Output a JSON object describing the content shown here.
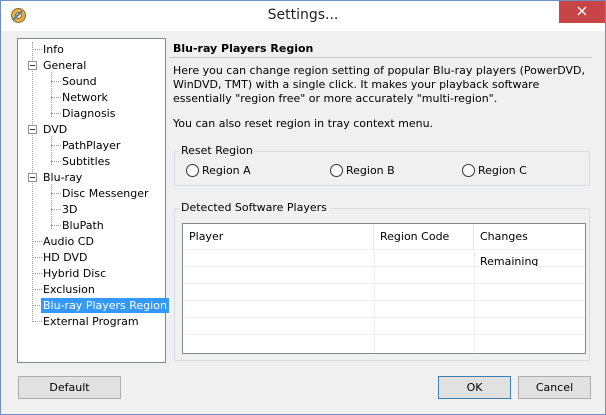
{
  "window": {
    "title": "Settings...",
    "app_icon": "gear-icon",
    "close_icon": "close-icon"
  },
  "tree": {
    "items": [
      {
        "label": "Info",
        "depth": 0,
        "expandable": false
      },
      {
        "label": "General",
        "depth": 0,
        "expandable": true,
        "expanded": true
      },
      {
        "label": "Sound",
        "depth": 1,
        "expandable": false
      },
      {
        "label": "Network",
        "depth": 1,
        "expandable": false
      },
      {
        "label": "Diagnosis",
        "depth": 1,
        "expandable": false
      },
      {
        "label": "DVD",
        "depth": 0,
        "expandable": true,
        "expanded": true
      },
      {
        "label": "PathPlayer",
        "depth": 1,
        "expandable": false
      },
      {
        "label": "Subtitles",
        "depth": 1,
        "expandable": false
      },
      {
        "label": "Blu-ray",
        "depth": 0,
        "expandable": true,
        "expanded": true
      },
      {
        "label": "Disc Messenger",
        "depth": 1,
        "expandable": false
      },
      {
        "label": "3D",
        "depth": 1,
        "expandable": false
      },
      {
        "label": "BluPath",
        "depth": 1,
        "expandable": false
      },
      {
        "label": "Audio CD",
        "depth": 0,
        "expandable": false
      },
      {
        "label": "HD DVD",
        "depth": 0,
        "expandable": false
      },
      {
        "label": "Hybrid Disc",
        "depth": 0,
        "expandable": false
      },
      {
        "label": "Exclusion",
        "depth": 0,
        "expandable": false
      },
      {
        "label": "Blu-ray Players Region",
        "depth": 0,
        "expandable": false,
        "selected": true
      },
      {
        "label": "External Program",
        "depth": 0,
        "expandable": false
      }
    ]
  },
  "panel": {
    "header": "Blu-ray Players Region",
    "description": "Here you can change region setting of popular Blu-ray players (PowerDVD, WinDVD, TMT) with a single click. It makes your playback software essentially \"region free\" or more accurately \"multi-region\".",
    "tray_note": "You can also reset region in tray context menu.",
    "reset_group": {
      "title": "Reset Region",
      "options": [
        "Region A",
        "Region B",
        "Region C"
      ]
    },
    "detected_group": {
      "title": "Detected Software Players",
      "columns": [
        "Player",
        "Region Code",
        "Changes Remaining"
      ],
      "rows": []
    }
  },
  "buttons": {
    "default": "Default",
    "ok": "OK",
    "cancel": "Cancel"
  },
  "colors": {
    "selection": "#3399ff",
    "close_button": "#c74545"
  }
}
